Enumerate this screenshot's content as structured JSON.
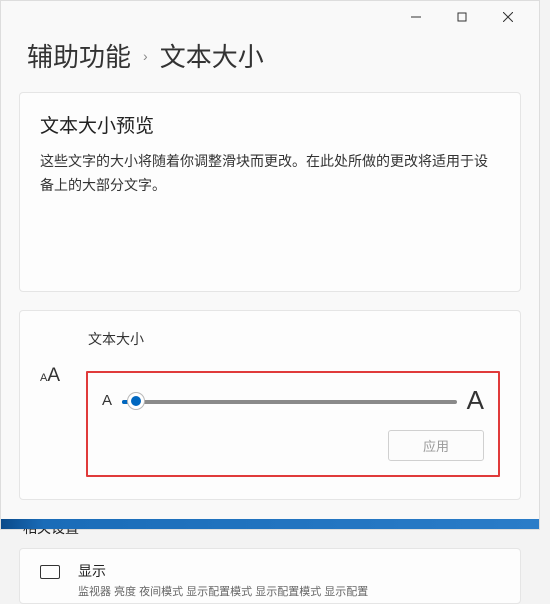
{
  "breadcrumb": {
    "parent": "辅助功能",
    "current": "文本大小"
  },
  "preview": {
    "title": "文本大小预览",
    "body": "这些文字的大小将随着你调整滑块而更改。在此处所做的更改将适用于设备上的大部分文字。"
  },
  "slider": {
    "label": "文本大小",
    "small": "A",
    "large": "A",
    "apply": "应用"
  },
  "related": {
    "header": "相关设置",
    "item": {
      "title": "显示",
      "sub": "监视器  亮度  夜间模式  显示配置模式  显示配置模式  显示配置"
    }
  }
}
